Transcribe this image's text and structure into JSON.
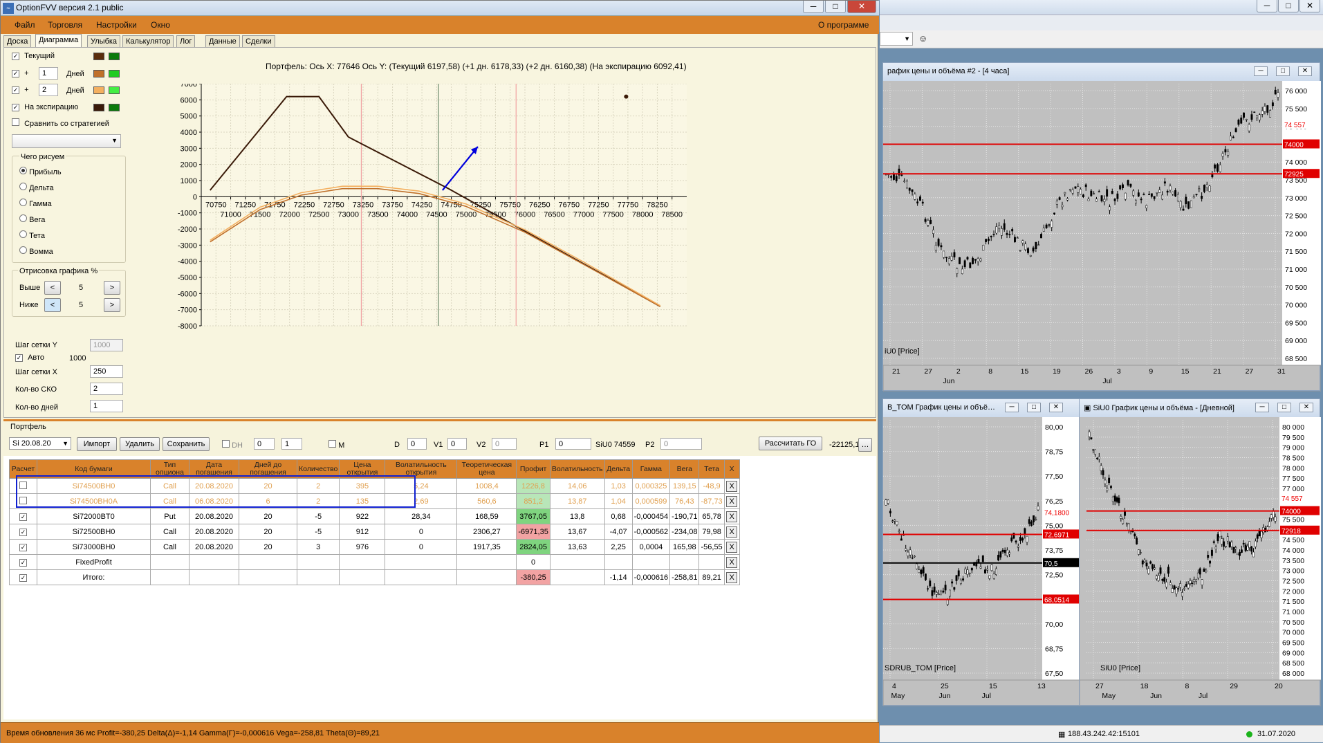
{
  "window": {
    "title": "OptionFVV версия 2.1 public",
    "min": "─",
    "max": "□",
    "close": "✕",
    "icon": "chart-app-icon"
  },
  "menu": {
    "items": [
      "Файл",
      "Торговля",
      "Настройки",
      "Окно"
    ],
    "about": "О программе"
  },
  "tabs": [
    "Доска",
    "Диаграмма",
    "Улыбка",
    "Калькулятор",
    "Лог",
    "Данные",
    "Сделки"
  ],
  "left_panel": {
    "current_label": "Текущий",
    "plus": "+",
    "days_label": "Дней",
    "day1": "1",
    "day2": "2",
    "expiry_label": "На экспирацию",
    "compare_label": "Сравнить со стратегией",
    "what_title": "Чего рисуем",
    "radios": [
      "Прибыль",
      "Дельта",
      "Гамма",
      "Вега",
      "Тета",
      "Вомма"
    ],
    "draw_title": "Отрисовка графика %",
    "above_label": "Выше",
    "above_val": "5",
    "below_label": "Ниже",
    "below_val": "5",
    "gridy_label": "Шаг сетки Y",
    "gridy_val": "1000",
    "auto_label": "Авто",
    "auto_val": "1000",
    "gridx_label": "Шаг сетки X",
    "gridx_val": "250",
    "sko_label": "Кол-во СКО",
    "sko_val": "2",
    "days_count_label": "Кол-во дней",
    "days_count_val": "1",
    "colors": {
      "current": "#5a2d0c",
      "current2": "#1a8a1a",
      "d1": "#c0702a",
      "d1b": "#22cc22",
      "d2": "#f4b060",
      "d2b": "#44ee44",
      "exp": "#3a1a08",
      "expb": "#0b7a0b"
    }
  },
  "chart_data": {
    "type": "line",
    "title": "Портфель: Ось X: 77646 Ось Y: (Текущий 6197,58) (+1 дн. 6178,33) (+2 дн. 6160,38) (На экспирацию 6092,41)",
    "x_ticks_upper": [
      "70750",
      "71250",
      "71750",
      "72250",
      "72750",
      "73250",
      "73750",
      "74250",
      "74750",
      "75250",
      "75750",
      "76250",
      "76750",
      "77250",
      "77750",
      "78250"
    ],
    "x_ticks_lower": [
      "71000",
      "71500",
      "72000",
      "72500",
      "73000",
      "73500",
      "74000",
      "74500",
      "75000",
      "75500",
      "76000",
      "76500",
      "77000",
      "77500",
      "78000",
      "78500"
    ],
    "y_ticks": [
      "7000",
      "6000",
      "5000",
      "4000",
      "3000",
      "2000",
      "1000",
      "0",
      "-1000",
      "-2000",
      "-3000",
      "-4000",
      "-5000",
      "-6000",
      "-7000",
      "-8000"
    ],
    "xlim": [
      70500,
      78750
    ],
    "ylim": [
      -8000,
      7000
    ],
    "series": [
      {
        "color": "#3a1a08",
        "x": [
          70650,
          71950,
          72500,
          73000,
          74700,
          78300
        ],
        "y": [
          400,
          6200,
          6200,
          3700,
          500,
          -6800
        ]
      },
      {
        "color": "#c0702a",
        "x": [
          70650,
          71500,
          72200,
          72900,
          73500,
          74200,
          75000,
          76000,
          77000,
          78300
        ],
        "y": [
          -2800,
          -800,
          100,
          500,
          500,
          200,
          -600,
          -2200,
          -4200,
          -6800
        ]
      },
      {
        "color": "#f4b060",
        "x": [
          70650,
          71500,
          72200,
          72900,
          73500,
          74200,
          75000,
          76000,
          77000,
          78300
        ],
        "y": [
          -2700,
          -650,
          250,
          650,
          650,
          350,
          -450,
          -2050,
          -4050,
          -6750
        ]
      }
    ],
    "vlines": [
      {
        "x": 73220,
        "color": "#f0a0a0"
      },
      {
        "x": 74530,
        "color": "#6b8a6b"
      },
      {
        "x": 75850,
        "color": "#f0a0a0"
      }
    ],
    "arrow": {
      "x1": 74600,
      "y1": 400,
      "x2": 75200,
      "y2": 3100,
      "color": "#0000dd"
    },
    "marker": {
      "x": 77720,
      "y": 6200
    },
    "grid": true
  },
  "portfolio": {
    "title": "Портфель",
    "series_select": "Si 20.08.20",
    "import": "Импорт",
    "delete": "Удалить",
    "save": "Сохранить",
    "dh": "DH",
    "dh_v1": "0",
    "dh_v2": "1",
    "m": "M",
    "d_label": "D",
    "d_val": "0",
    "v1_label": "V1",
    "v1_val": "0",
    "v2_label": "V2",
    "v2_val": "0",
    "p1_label": "P1",
    "p1_val": "0",
    "siu": "SiU0 74559",
    "p2_label": "P2",
    "p2_val": "0",
    "calc_go": "Рассчитать ГО",
    "go_val": "-22125,1",
    "more": "…"
  },
  "table": {
    "headers": [
      "Расчет",
      "Код бумаги",
      "Тип опциона",
      "Дата погашения",
      "Дней до погашения",
      "Количество",
      "Цена открытия",
      "Волатильность открытия",
      "Теоретическая цена",
      "Профит",
      "Волатильность",
      "Дельта",
      "Гамма",
      "Вега",
      "Тета",
      "X"
    ],
    "rows": [
      {
        "dim": true,
        "chk": false,
        "cells": [
          "",
          "Si74500BH0",
          "Call",
          "20.08.2020",
          "20",
          "2",
          "395",
          "5,24",
          "1008,4",
          "1226,8",
          "14,06",
          "1,03",
          "0,000325",
          "139,15",
          "-48,9",
          "X"
        ],
        "profit": "dim"
      },
      {
        "dim": true,
        "chk": false,
        "cells": [
          "",
          "Si74500BH0A",
          "Call",
          "06.08.2020",
          "6",
          "2",
          "135",
          "2,69",
          "560,6",
          "851,2",
          "13,87",
          "1,04",
          "0,000599",
          "76,43",
          "-87,73",
          "X"
        ],
        "profit": "dim"
      },
      {
        "dim": false,
        "chk": true,
        "cells": [
          "",
          "Si72000BT0",
          "Put",
          "20.08.2020",
          "20",
          "-5",
          "922",
          "28,34",
          "168,59",
          "3767,05",
          "13,8",
          "0,68",
          "-0,000454",
          "-190,71",
          "65,78",
          "X"
        ],
        "profit": "g"
      },
      {
        "dim": false,
        "chk": true,
        "cells": [
          "",
          "Si72500BH0",
          "Call",
          "20.08.2020",
          "20",
          "-5",
          "912",
          "0",
          "2306,27",
          "-6971,35",
          "13,67",
          "-4,07",
          "-0,000562",
          "-234,08",
          "79,98",
          "X"
        ],
        "profit": "r"
      },
      {
        "dim": false,
        "chk": true,
        "cells": [
          "",
          "Si73000BH0",
          "Call",
          "20.08.2020",
          "20",
          "3",
          "976",
          "0",
          "1917,35",
          "2824,05",
          "13,63",
          "2,25",
          "0,0004",
          "165,98",
          "-56,55",
          "X"
        ],
        "profit": "g"
      },
      {
        "dim": false,
        "chk": true,
        "cells": [
          "",
          "FixedProfit",
          "",
          "",
          "",
          "",
          "",
          "",
          "",
          "0",
          "",
          "",
          "",
          "",
          "",
          "X"
        ],
        "profit": ""
      },
      {
        "dim": false,
        "chk": true,
        "cells": [
          "",
          "Итого:",
          "",
          "",
          "",
          "",
          "",
          "",
          "",
          "-380,25",
          "",
          "-1,14",
          "-0,000616",
          "-258,81",
          "89,21",
          "X"
        ],
        "profit": "r"
      }
    ]
  },
  "status": "Время обновления 36 мс  Profit=-380,25 Delta(Δ)=-1,14 Gamma(Γ)=-0,000616 Vega=-258,81 Theta(Θ)=89,21",
  "right": {
    "win1": {
      "title": "рафик цены и объёма #2 - [4 часа]",
      "series": "iU0 [Price]",
      "yticks": [
        "76 000",
        "75 500",
        "75 000",
        "74 500",
        "74 000",
        "73 500",
        "73 000",
        "72 500",
        "72 000",
        "71 500",
        "71 000",
        "70 500",
        "70 000",
        "69 500",
        "69 000",
        "68 500"
      ],
      "tags": [
        "74 557",
        "74000",
        "72925"
      ],
      "xticks": [
        "21",
        "27",
        "2",
        "8",
        "15",
        "19",
        "26",
        "3",
        "9",
        "15",
        "21",
        "27",
        "31"
      ],
      "months": [
        "Jun",
        "Jul"
      ]
    },
    "win2": {
      "title": "B_TOM График цены и объё…",
      "series": "SDRUB_TOM [Price]",
      "yticks": [
        "80,00",
        "78,75",
        "77,50",
        "76,25",
        "75,00",
        "73,75",
        "72,50",
        "71,25",
        "70,00",
        "68,75",
        "67,50"
      ],
      "tags": [
        "74,1800",
        "72,6971",
        "70,5",
        "68,0514"
      ],
      "xticks": [
        "4",
        "25",
        "15",
        "13"
      ],
      "months": [
        "May",
        "Jun",
        "Jul"
      ]
    },
    "win3": {
      "title": "SiU0 График цены и объёма - [Дневной]",
      "series": "SiU0 [Price]",
      "yticks": [
        "80 000",
        "79 500",
        "79 000",
        "78 500",
        "78 000",
        "77 500",
        "77 000",
        "76 500",
        "76 000",
        "75 500",
        "75 000",
        "74 500",
        "74 000",
        "73 500",
        "73 000",
        "72 500",
        "72 000",
        "71 500",
        "71 000",
        "70 500",
        "70 000",
        "69 500",
        "69 000",
        "68 500",
        "68 000"
      ],
      "tags": [
        "74 557",
        "74000",
        "72918"
      ],
      "xticks": [
        "27",
        "18",
        "8",
        "29",
        "20"
      ],
      "months": [
        "May",
        "Jun",
        "Jul"
      ]
    },
    "ip": "188.43.242.42:15101",
    "date": "31.07.2020"
  }
}
